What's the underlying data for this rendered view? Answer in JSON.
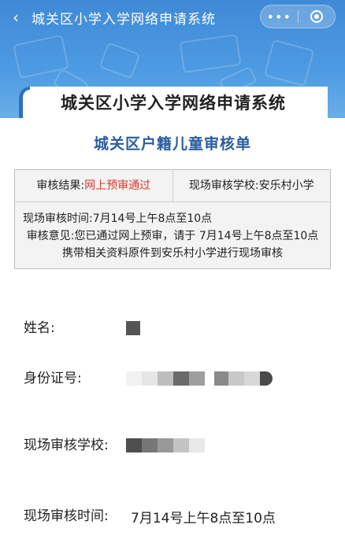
{
  "navbar": {
    "back_icon": "chevron-left-icon",
    "title": "城关区小学入学网络申请系统",
    "more_label": "•••",
    "close_icon": "target-circle-icon"
  },
  "banner": {
    "title": "城关区小学入学网络申请系统"
  },
  "form": {
    "title": "城关区户籍儿童审核单",
    "result_label": "审核结果:",
    "result_value": "网上预审通过",
    "school_label": "现场审核学校:",
    "school_value": "安乐村小学",
    "time_line": "现场审核时间:7月14号上午8点至10点",
    "opinion_text": "审核意见:您已通过网上预审，请于 7月14号上午8点至10点 携带相关资料原件到安乐村小学进行现场审核"
  },
  "fields": {
    "name_label": "姓名:",
    "id_label": "身份证号:",
    "school_label": "现场审核学校:",
    "time_label": "现场审核时间:",
    "time_value": "7月14号上午8点至10点"
  },
  "colors": {
    "header_blue": "#3f8ad6",
    "title_blue": "#2a5c9e",
    "result_red": "#d23a2e"
  }
}
